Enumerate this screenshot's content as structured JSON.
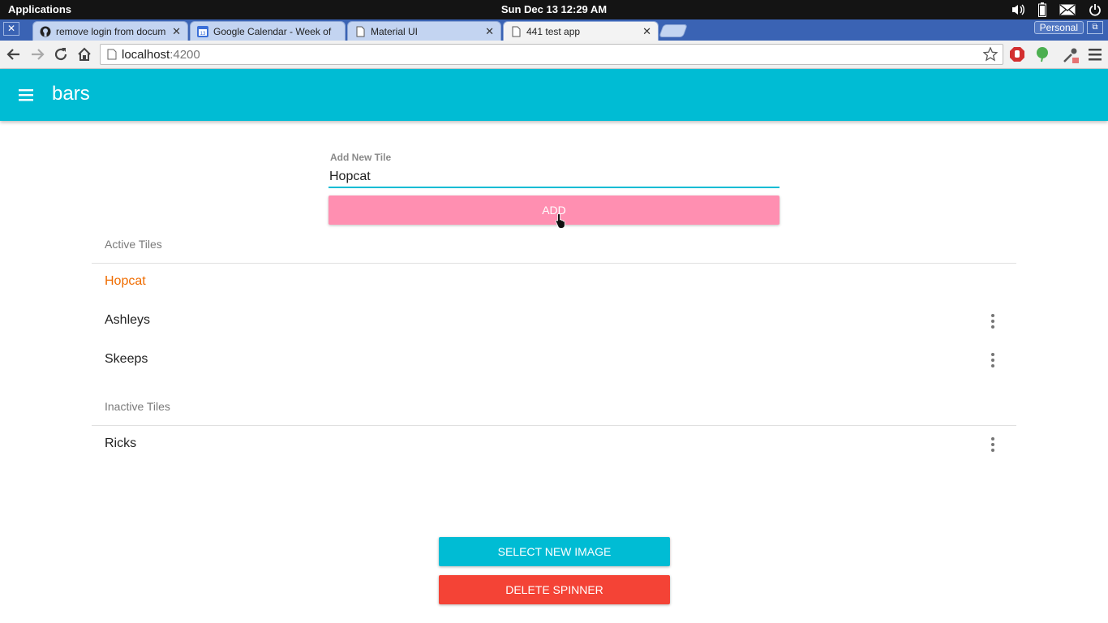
{
  "os": {
    "apps_label": "Applications",
    "clock": "Sun Dec 13 12:29 AM",
    "tray_icons": [
      "volume-icon",
      "battery-icon",
      "mail-icon",
      "power-icon"
    ]
  },
  "browser": {
    "tabs": [
      {
        "title": "remove login from docum",
        "icon": "github-icon",
        "active": false
      },
      {
        "title": "Google Calendar - Week of",
        "icon": "calendar-icon",
        "active": false
      },
      {
        "title": "Material UI",
        "icon": "page-icon",
        "active": false
      },
      {
        "title": "441 test app",
        "icon": "page-icon",
        "active": true
      }
    ],
    "profile_label": "Personal",
    "url_host": "localhost",
    "url_port": ":4200"
  },
  "app": {
    "title": "bars",
    "accent_color": "#00bcd4",
    "add_form": {
      "label": "Add New Tile",
      "value": "Hopcat",
      "add_button": "ADD"
    },
    "active_section": {
      "header": "Active Tiles",
      "items": [
        "Hopcat",
        "Ashleys",
        "Skeeps"
      ]
    },
    "inactive_section": {
      "header": "Inactive Tiles",
      "items": [
        "Ricks"
      ]
    },
    "select_image_button": "SELECT NEW IMAGE",
    "delete_spinner_button": "DELETE SPINNER",
    "colors": {
      "add_button": "#ff8fb1",
      "highlight_item": "#ef6c00",
      "delete_button": "#f44336"
    }
  }
}
